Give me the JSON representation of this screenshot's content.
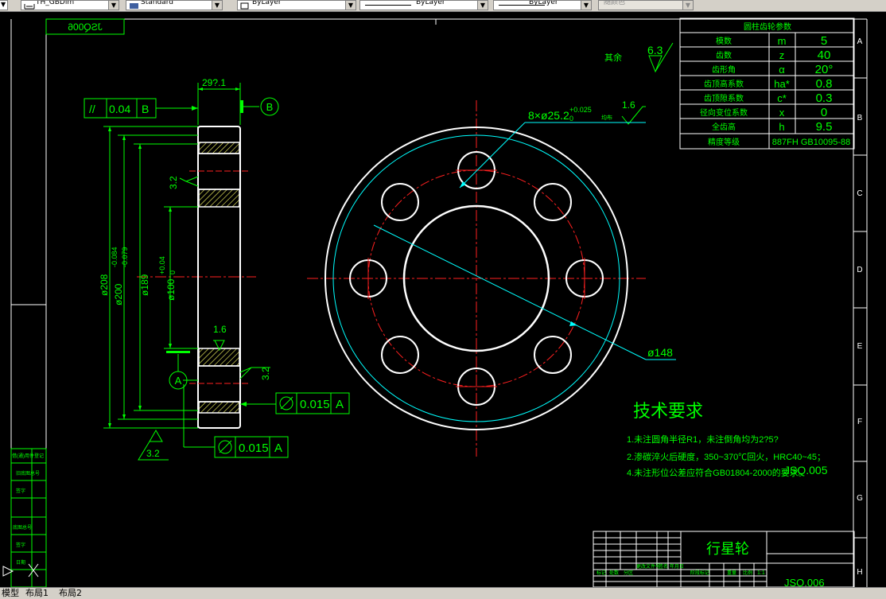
{
  "toolbar": {
    "dimstyle": "TH_GBDim",
    "textstyle": "Standard",
    "layer": "ByLayer",
    "linetype": "ByLayer",
    "lineweight": "ByLayer",
    "color": "随颜色"
  },
  "tabs": [
    "模型",
    "布局1",
    "布局2"
  ],
  "drawing": {
    "stamp_mirrored": "JSQ006",
    "surface_rest": "其余",
    "surface_rest_value": "6.3",
    "datum_b": "B",
    "datum_a": "A",
    "tolerance_top": {
      "symbol": "//",
      "value": "0.04",
      "datum": "B"
    },
    "tolerance_mid": {
      "value": "0.015",
      "datum": "A"
    },
    "tolerance_bot": {
      "value": "0.015",
      "datum": "A"
    },
    "dims": {
      "width": "29?.1",
      "d208": "ø208",
      "d200": "ø200",
      "d200_upper": "-0.084",
      "d200_lower": "-0.079",
      "d189": "ø189",
      "d100": "ø100",
      "d100_upper": "+0.04",
      "d100_lower": "0",
      "r32a": "3.2",
      "r32b": "3.2",
      "r32c": "3.2",
      "r16a": "1.6",
      "r16b": "1.6",
      "holes": "8×ø25.2",
      "holes_upper": "+0.025",
      "holes_lower": "0",
      "holes_suffix": "均布",
      "d148": "ø148"
    },
    "tech_title": "技术要求",
    "tech_notes": [
      "1.未注圆角半径R1，未注倒角均为2?5?",
      "2.渗碳淬火后硬度，350~370℃回火，HRC40~45；",
      "4.未注形位公差应符合GB01804-2000的要求。"
    ],
    "part_code": "JSQ.005",
    "gear_table": {
      "title": "圆柱齿轮参数",
      "rows": [
        [
          "模数",
          "m",
          "5"
        ],
        [
          "齿数",
          "z",
          "40"
        ],
        [
          "齿形角",
          "α",
          "20°"
        ],
        [
          "齿顶高系数",
          "ha*",
          "0.8"
        ],
        [
          "齿顶隙系数",
          "c*",
          "0.3"
        ],
        [
          "径向变位系数",
          "x",
          "0"
        ],
        [
          "全齿高",
          "h",
          "9.5"
        ],
        [
          "精度等级",
          "887FH GB10095-88",
          ""
        ]
      ]
    },
    "title_block": {
      "name": "行星轮",
      "code": "JSQ.006",
      "scale": "1:1",
      "labels": [
        "标记",
        "处数",
        "分区",
        "更改文件号",
        "签名",
        "年月日",
        "阶段标记",
        "重量",
        "比例"
      ]
    },
    "left_strip": [
      "借(通)用件登记",
      "旧底图总号",
      "底图总号",
      "签字",
      "日期"
    ],
    "zone_letters": [
      "A",
      "B",
      "C",
      "D",
      "E",
      "F",
      "G",
      "H"
    ],
    "axis": {
      "x": "X",
      "y": "Y"
    },
    "colors": {
      "outline": "#ffffff",
      "dim": "#00ff00",
      "center": "#ff2020",
      "pitch": "#00ffff",
      "hatch": "#ffff66"
    }
  }
}
